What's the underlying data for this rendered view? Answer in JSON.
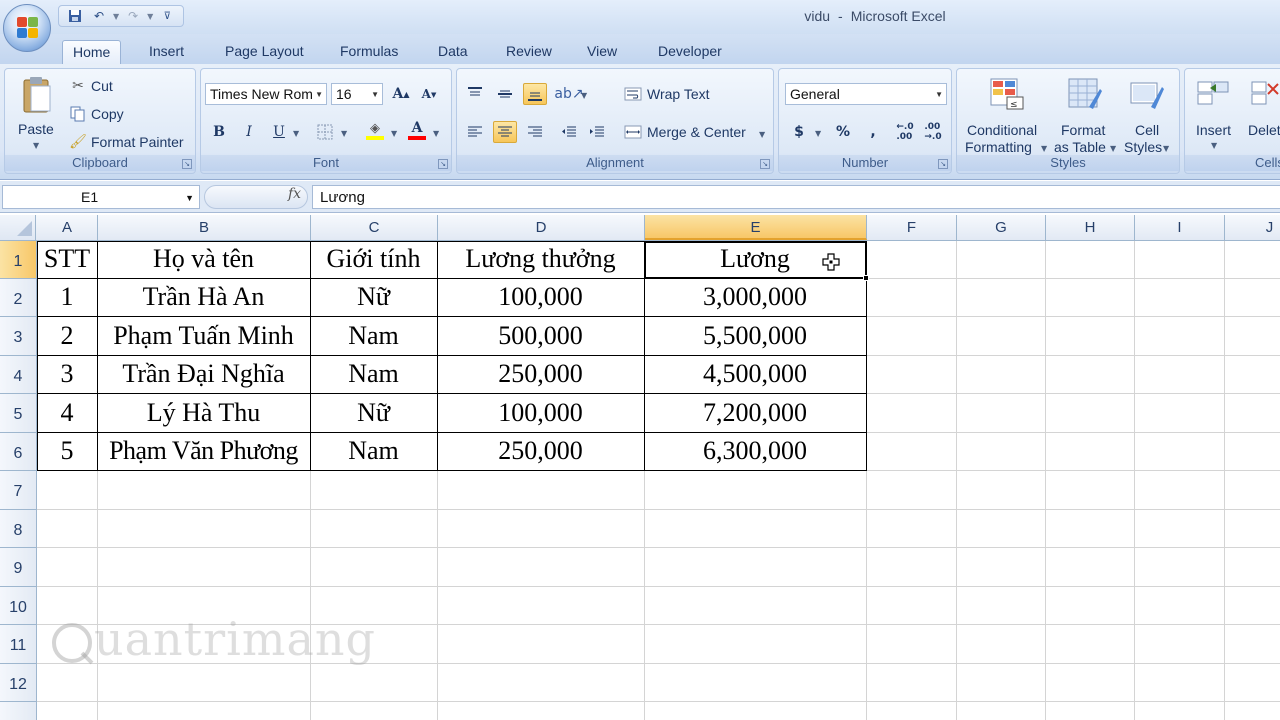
{
  "window": {
    "doc_name": "vidu",
    "separator": "-",
    "app_name": "Microsoft Excel"
  },
  "tabs": [
    "Home",
    "Insert",
    "Page Layout",
    "Formulas",
    "Data",
    "Review",
    "View",
    "Developer"
  ],
  "ribbon": {
    "clipboard": {
      "paste": "Paste",
      "cut": "Cut",
      "copy": "Copy",
      "format_painter": "Format Painter",
      "label": "Clipboard"
    },
    "font": {
      "name": "Times New Rom",
      "size": "16",
      "bold": "B",
      "italic": "I",
      "underline": "U",
      "label": "Font"
    },
    "alignment": {
      "wrap_text": "Wrap Text",
      "merge_center": "Merge & Center",
      "label": "Alignment"
    },
    "number": {
      "format": "General",
      "currency": "$",
      "percent": "%",
      "comma": ",",
      "label": "Number"
    },
    "styles": {
      "conditional": "Conditional",
      "formatting": "Formatting",
      "format": "Format",
      "as_table": "as Table",
      "cell": "Cell",
      "cell_styles": "Styles",
      "label": "Styles"
    },
    "cells": {
      "insert": "Insert",
      "delete": "Delete",
      "label": "Cells"
    },
    "colors": {
      "highlight": "#ffff00",
      "font_color": "#ff0000"
    }
  },
  "formula_bar": {
    "name_box": "E1",
    "fx": "fx",
    "content": "Lương"
  },
  "columns": [
    "A",
    "B",
    "C",
    "D",
    "E",
    "F",
    "G",
    "H",
    "I",
    "J"
  ],
  "selected_column": "E",
  "rows": [
    "1",
    "2",
    "3",
    "4",
    "5",
    "6",
    "7",
    "8",
    "9",
    "10",
    "11",
    "12"
  ],
  "table": {
    "header": [
      "STT",
      "Họ và tên",
      "Giới tính",
      "Lương thưởng",
      "Lương"
    ],
    "rows": [
      [
        "1",
        "Trần Hà An",
        "Nữ",
        "100,000",
        "3,000,000"
      ],
      [
        "2",
        "Phạm Tuấn Minh",
        "Nam",
        "500,000",
        "5,500,000"
      ],
      [
        "3",
        "Trần Đại Nghĩa",
        "Nam",
        "250,000",
        "4,500,000"
      ],
      [
        "4",
        "Lý Hà Thu",
        "Nữ",
        "100,000",
        "7,200,000"
      ],
      [
        "5",
        "Phạm Văn Phương",
        "Nam",
        "250,000",
        "6,300,000"
      ]
    ]
  },
  "watermark": "uantrimang"
}
